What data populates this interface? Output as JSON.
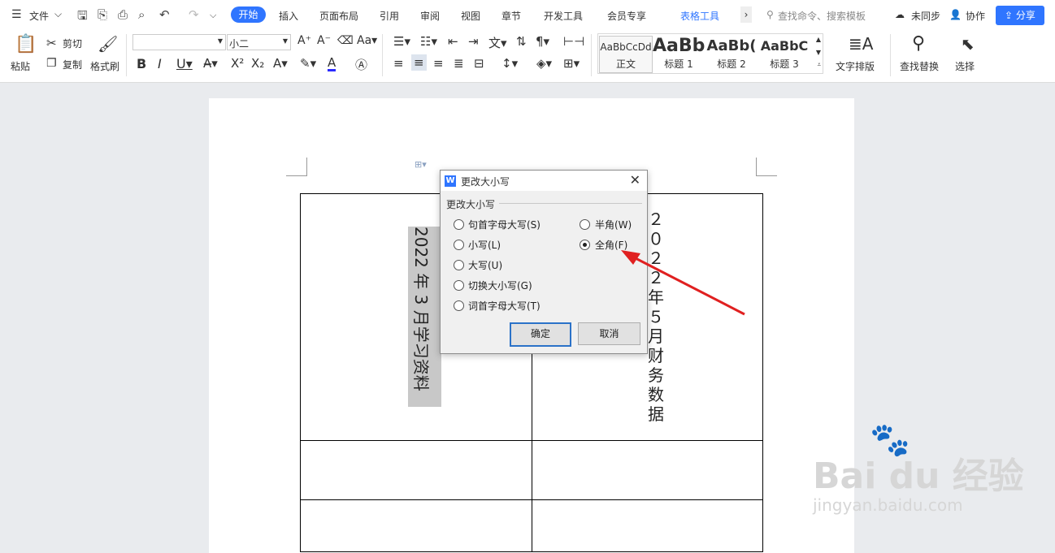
{
  "menubar": {
    "file": "文件",
    "tabs": [
      "开始",
      "插入",
      "页面布局",
      "引用",
      "审阅",
      "视图",
      "章节",
      "开发工具",
      "会员专享"
    ],
    "context_tab": "表格工具",
    "search_placeholder": "查找命令、搜索模板",
    "sync": "未同步",
    "collab": "协作",
    "share": "分享"
  },
  "ribbon": {
    "paste": "粘贴",
    "cut": "剪切",
    "copy": "复制",
    "format_painter": "格式刷",
    "font_size": "小二",
    "styles": [
      {
        "sample": "AaBbCcDd",
        "name": "正文"
      },
      {
        "sample": "AaBb",
        "name": "标题 1"
      },
      {
        "sample": "AaBb(",
        "name": "标题 2"
      },
      {
        "sample": "AaBbC",
        "name": "标题 3"
      }
    ],
    "text_layout": "文字排版",
    "find_replace": "查找替换",
    "select": "选择"
  },
  "document": {
    "left_cell_text": "2022 年 3 月学习资料",
    "right_cell_chars": [
      "２",
      "０",
      "２",
      "２",
      "年",
      "５",
      "月",
      "财",
      "务",
      "数",
      "据"
    ]
  },
  "dialog": {
    "title": "更改大小写",
    "group_label": "更改大小写",
    "options_left": [
      "句首字母大写(S)",
      "小写(L)",
      "大写(U)",
      "切换大小写(G)",
      "词首字母大写(T)"
    ],
    "options_right": [
      "半角(W)",
      "全角(F)"
    ],
    "selected": "全角(F)",
    "ok": "确定",
    "cancel": "取消"
  },
  "colors": {
    "accent": "#2f75ff",
    "arrow": "#e02020"
  },
  "watermark": "Bai du 经验 jingyan.baidu.com"
}
